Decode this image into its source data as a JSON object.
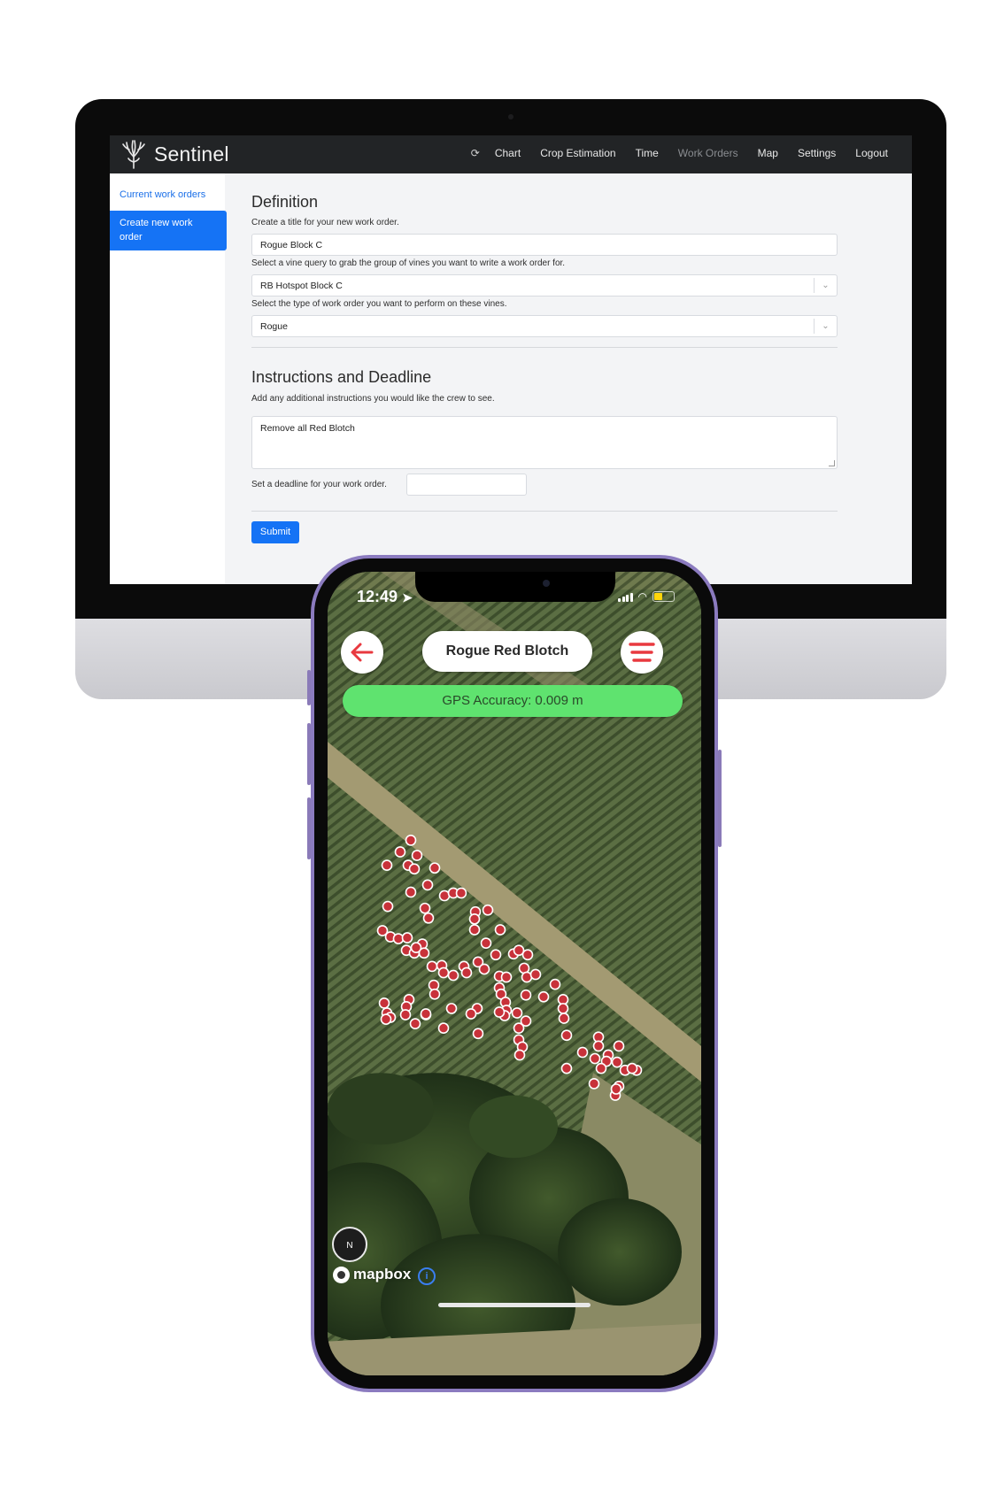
{
  "desktop": {
    "brand": "Sentinel",
    "nav": {
      "chart": "Chart",
      "crop_estimation": "Crop Estimation",
      "time": "Time",
      "work_orders": "Work Orders",
      "map": "Map",
      "settings": "Settings",
      "logout": "Logout"
    },
    "sidebar": {
      "current": "Current work orders",
      "create": "Create new work order"
    },
    "definition": {
      "heading": "Definition",
      "title_label": "Create a title for your new work order.",
      "title_value": "Rogue Block C",
      "query_label": "Select a vine query to grab the group of vines you want to write a work order for.",
      "query_value": "RB Hotspot Block C",
      "type_label": "Select the type of work order you want to perform on these vines.",
      "type_value": "Rogue"
    },
    "instructions": {
      "heading": "Instructions and Deadline",
      "instr_label": "Add any additional instructions you would like the crew to see.",
      "instr_value": "Remove all Red Blotch",
      "deadline_label": "Set a deadline for your work order.",
      "deadline_value": ""
    },
    "submit": "Submit"
  },
  "mobile": {
    "status_time": "12:49",
    "battery_level": 0.45,
    "title": "Rogue Red Blotch",
    "gps": "GPS Accuracy: 0.009 m",
    "compass_label": "N",
    "mapbox": "mapbox",
    "info": "i"
  },
  "colors": {
    "accent": "#1573f5",
    "navbar": "#222426",
    "marker": "#c8323a",
    "gps_ok": "#5fe36f",
    "phone_frame": "#8b7bbf"
  }
}
